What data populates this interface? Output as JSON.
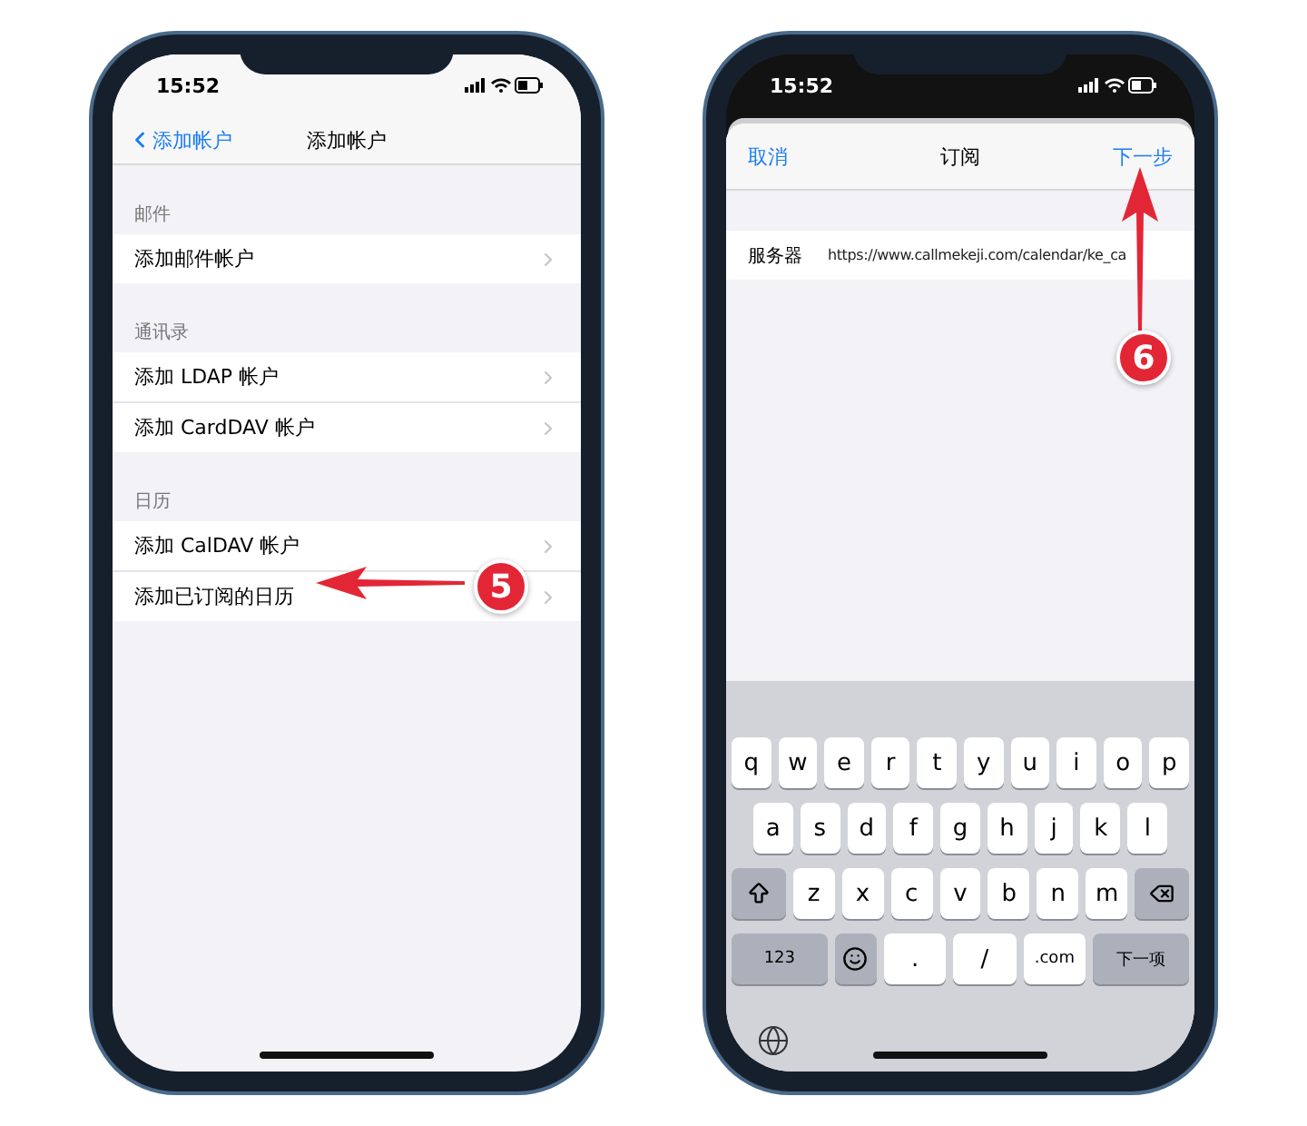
{
  "phones": [
    {
      "kind": "settings",
      "status_time": "15:52",
      "nav": {
        "back_label": "添加帐户",
        "title": "添加帐户"
      },
      "sections": [
        {
          "header": "邮件",
          "rows": [
            {
              "label": "添加邮件帐户"
            }
          ]
        },
        {
          "header": "通讯录",
          "rows": [
            {
              "label": "添加 LDAP 帐户"
            },
            {
              "label": "添加 CardDAV 帐户"
            }
          ]
        },
        {
          "header": "日历",
          "rows": [
            {
              "label": "添加 CalDAV 帐户"
            },
            {
              "label": "添加已订阅的日历"
            }
          ]
        }
      ],
      "annotation": {
        "label": "5"
      }
    },
    {
      "kind": "form",
      "status_time": "15:52",
      "nav": {
        "cancel": "取消",
        "title": "订阅",
        "next": "下一步"
      },
      "fields": [
        {
          "label": "服务器",
          "value": "https://www.callmekeji.com/calendar/ke_ca"
        }
      ],
      "keyboard": {
        "rows": [
          {
            "keys": [
              {
                "kind": "char",
                "label": "q"
              },
              {
                "kind": "char",
                "label": "w"
              },
              {
                "kind": "char",
                "label": "e"
              },
              {
                "kind": "char",
                "label": "r"
              },
              {
                "kind": "char",
                "label": "t"
              },
              {
                "kind": "char",
                "label": "y"
              },
              {
                "kind": "char",
                "label": "u"
              },
              {
                "kind": "char",
                "label": "i"
              },
              {
                "kind": "char",
                "label": "o"
              },
              {
                "kind": "char",
                "label": "p"
              }
            ]
          },
          {
            "keys": [
              {
                "kind": "char",
                "label": "a"
              },
              {
                "kind": "char",
                "label": "s"
              },
              {
                "kind": "char",
                "label": "d"
              },
              {
                "kind": "char",
                "label": "f"
              },
              {
                "kind": "char",
                "label": "g"
              },
              {
                "kind": "char",
                "label": "h"
              },
              {
                "kind": "char",
                "label": "j"
              },
              {
                "kind": "char",
                "label": "k"
              },
              {
                "kind": "char",
                "label": "l"
              }
            ]
          },
          {
            "keys": [
              {
                "kind": "shift"
              },
              {
                "kind": "char",
                "label": "z"
              },
              {
                "kind": "char",
                "label": "x"
              },
              {
                "kind": "char",
                "label": "c"
              },
              {
                "kind": "char",
                "label": "v"
              },
              {
                "kind": "char",
                "label": "b"
              },
              {
                "kind": "char",
                "label": "n"
              },
              {
                "kind": "char",
                "label": "m"
              },
              {
                "kind": "delete"
              }
            ]
          },
          {
            "keys": [
              {
                "kind": "func",
                "label": "123"
              },
              {
                "kind": "emoji"
              },
              {
                "kind": "char",
                "label": "."
              },
              {
                "kind": "char",
                "label": "/"
              },
              {
                "kind": "char",
                "label": ".com"
              },
              {
                "kind": "func",
                "label": "下一项"
              }
            ]
          }
        ]
      },
      "annotation": {
        "label": "6"
      }
    }
  ]
}
